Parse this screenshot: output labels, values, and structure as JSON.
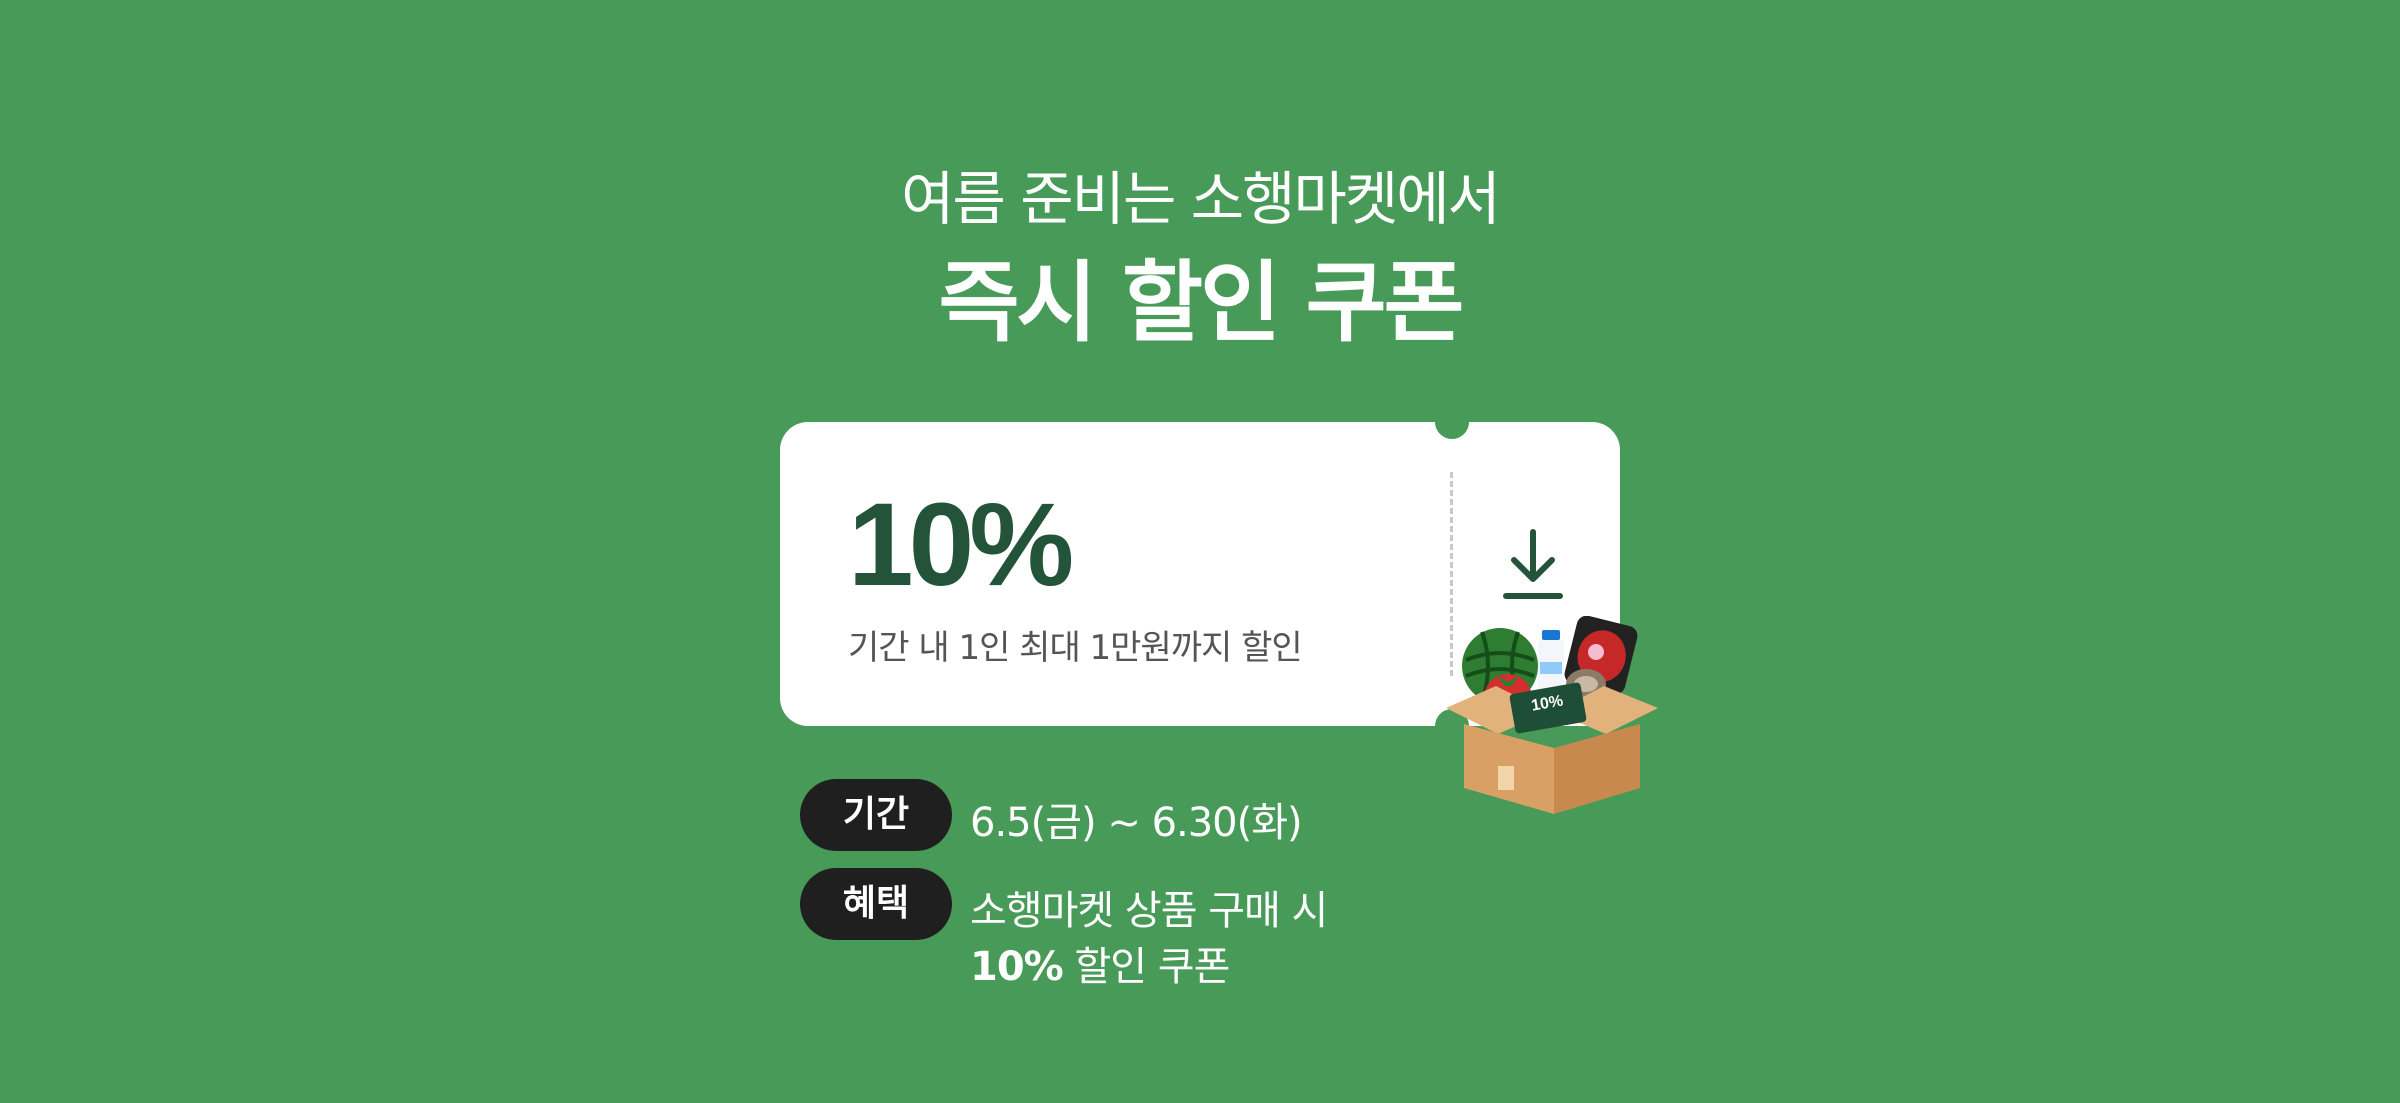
{
  "header": {
    "subtitle": "여름 준비는 소행마켓에서",
    "title": "즉시 할인 쿠폰"
  },
  "coupon": {
    "discount": "10%",
    "description": "기간 내 1인 최대 1만원까지 할인",
    "download_icon": "download-icon",
    "box_badge": "10%"
  },
  "info": {
    "period_label": "기간",
    "period_value": "6.5(금) ~ 6.30(화)",
    "benefit_label": "혜택",
    "benefit_line1": "소행마켓 상품 구매 시",
    "benefit_line2_strong": "10%",
    "benefit_line2_rest": " 할인 쿠폰"
  },
  "colors": {
    "background": "#479a58",
    "accent": "#235339",
    "pill": "#1f1f1f"
  }
}
